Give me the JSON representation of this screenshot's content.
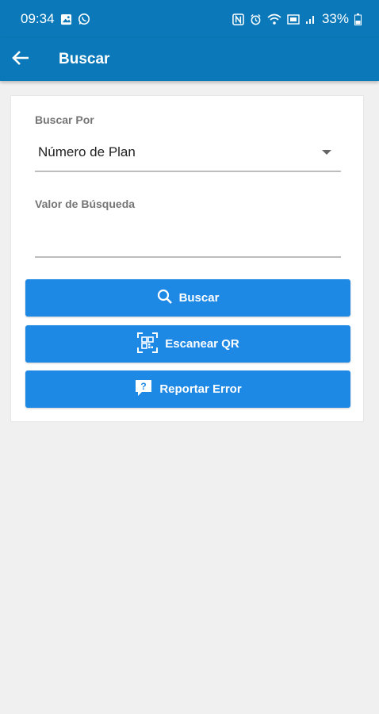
{
  "status_bar": {
    "time": "09:34",
    "battery": "33%",
    "left_icons": [
      "gallery-icon",
      "whatsapp-icon"
    ],
    "right_icons": [
      "nfc-icon",
      "alarm-icon",
      "wifi-icon",
      "volte-icon",
      "signal-icon",
      "battery-icon"
    ]
  },
  "app_bar": {
    "title": "Buscar",
    "back_icon": "arrow-left-icon",
    "color": "#0b79b9"
  },
  "form": {
    "search_by_label": "Buscar Por",
    "search_by_value": "Número de Plan",
    "search_value_label": "Valor de Búsqueda",
    "search_value": ""
  },
  "buttons": {
    "search": {
      "label": "Buscar",
      "icon": "search-icon"
    },
    "scan_qr": {
      "label": "Escanear QR",
      "icon": "qr-scan-icon"
    },
    "report_error": {
      "label": "Reportar Error",
      "icon": "report-icon"
    },
    "color": "#1e88e5"
  }
}
